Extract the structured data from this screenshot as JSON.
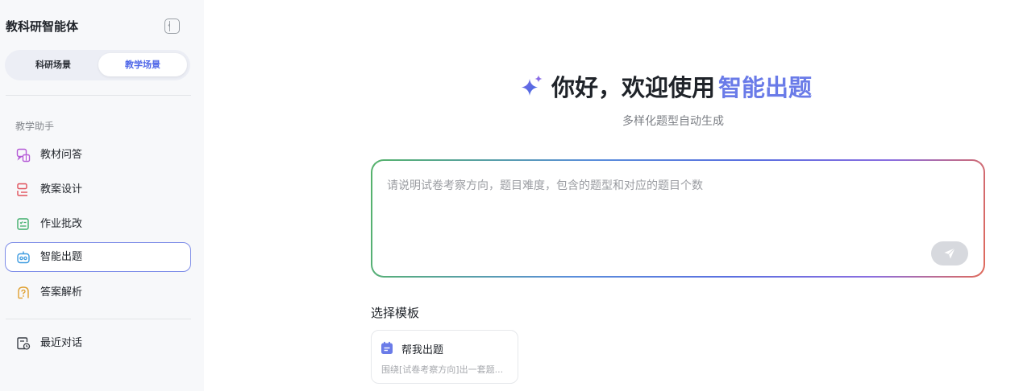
{
  "sidebar": {
    "app_title": "教科研智能体",
    "tabs": [
      {
        "label": "科研场景",
        "active": false
      },
      {
        "label": "教学场景",
        "active": true
      }
    ],
    "section_label": "教学助手",
    "items": [
      {
        "label": "教材问答",
        "icon": "chat-book-icon"
      },
      {
        "label": "教案设计",
        "icon": "lesson-plan-icon"
      },
      {
        "label": "作业批改",
        "icon": "homework-check-icon"
      },
      {
        "label": "智能出题",
        "icon": "robot-icon",
        "active": true
      },
      {
        "label": "答案解析",
        "icon": "answer-analysis-icon"
      }
    ],
    "recent": {
      "label": "最近对话",
      "icon": "history-icon"
    }
  },
  "hero": {
    "title_prefix": "你好，欢迎使用",
    "title_accent": "智能出题",
    "subtitle": "多样化题型自动生成"
  },
  "input": {
    "placeholder": "请说明试卷考察方向，题目难度，包含的题型和对应的题目个数",
    "value": ""
  },
  "templates": {
    "heading": "选择模板",
    "items": [
      {
        "title": "帮我出题",
        "desc": "围绕[试卷考察方向]出一套题..."
      }
    ]
  },
  "colors": {
    "accent": "#6a7be8",
    "active_tab": "#4f67e8",
    "sidebar_bg": "#f7f8fa"
  }
}
